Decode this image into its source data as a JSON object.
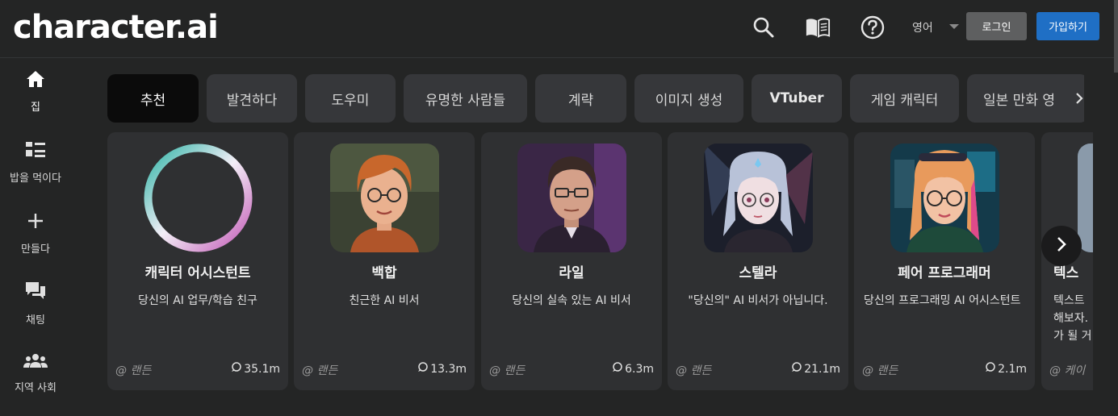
{
  "header": {
    "logo": "character.ai",
    "language": "영어",
    "login_label": "로그인",
    "signup_label": "가입하기",
    "icons": [
      "search-icon",
      "book-icon",
      "help-icon"
    ]
  },
  "sidebar": {
    "items": [
      {
        "label": "집",
        "icon": "home-icon"
      },
      {
        "label": "밥을 먹이다",
        "icon": "feed-icon"
      },
      {
        "label": "만들다",
        "icon": "plus-icon"
      },
      {
        "label": "채팅",
        "icon": "chat-icon"
      },
      {
        "label": "지역 사회",
        "icon": "community-icon"
      }
    ]
  },
  "categories": [
    "추천",
    "발견하다",
    "도우미",
    "유명한 사람들",
    "계략",
    "이미지 생성",
    "VTuber",
    "게임 캐릭터",
    "일본 만화 영"
  ],
  "cards": [
    {
      "name": "캐릭터 어시스턴트",
      "desc": "당신의 AI 업무/학습 친구",
      "author": "@ 랜든",
      "count": "35.1m"
    },
    {
      "name": "백합",
      "desc": "친근한 AI 비서",
      "author": "@ 랜든",
      "count": "13.3m"
    },
    {
      "name": "라일",
      "desc": "당신의 실속 있는 AI 비서",
      "author": "@ 랜든",
      "count": "6.3m"
    },
    {
      "name": "스텔라",
      "desc": "\"당신의\" AI 비서가 아닙니다.",
      "author": "@ 랜든",
      "count": "21.1m"
    },
    {
      "name": "페어 프로그래머",
      "desc": "당신의 프로그래밍 AI 어시스턴트",
      "author": "@ 랜든",
      "count": "2.1m"
    },
    {
      "name": "텍스",
      "desc": "텍스트 해보자. 가 될 거",
      "author": "@ 케이",
      "count": ""
    }
  ],
  "colors": {
    "background": "#242525",
    "card": "#2f3032",
    "pill": "#36373a",
    "pill_active": "#0b0b0b",
    "signup": "#1f6fc5",
    "login": "#5e5f60"
  }
}
